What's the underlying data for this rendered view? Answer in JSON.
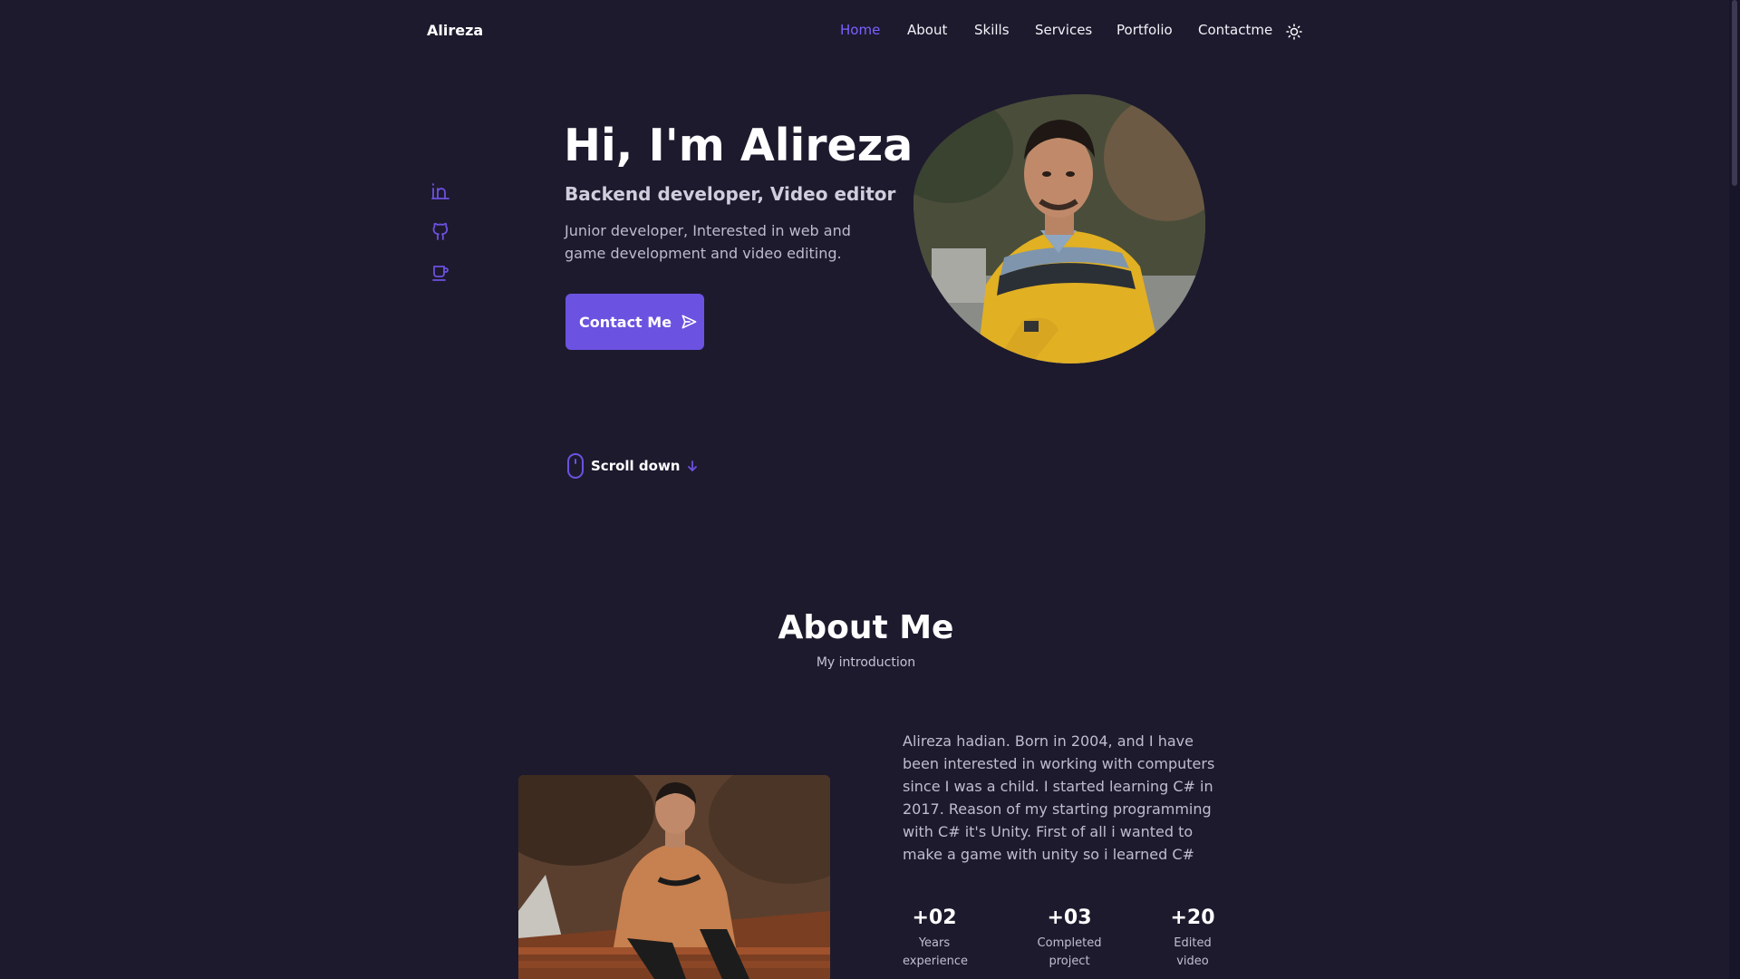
{
  "colors": {
    "background": "#1d1a2e",
    "accent": "#6c52e0",
    "nav_active": "#7b61ff",
    "text": "#ffffff",
    "muted_text": "#bfbdcd"
  },
  "header": {
    "brand": "Alireza",
    "nav": [
      {
        "label": "Home",
        "active": true
      },
      {
        "label": "About",
        "active": false
      },
      {
        "label": "Skills",
        "active": false
      },
      {
        "label": "Services",
        "active": false
      },
      {
        "label": "Portfolio",
        "active": false
      },
      {
        "label": "Contactme",
        "active": false
      }
    ],
    "theme_toggle_icon": "sun-icon"
  },
  "socials": [
    {
      "icon": "linkedin-icon"
    },
    {
      "icon": "github-icon"
    },
    {
      "icon": "coffee-cup-icon"
    }
  ],
  "hero": {
    "title": "Hi, I'm Alireza",
    "subtitle": "Backend developer, Video editor",
    "description": "Junior developer, Interested in web and game development and video editing.",
    "cta_label": "Contact Me",
    "cta_icon": "send-icon",
    "photo_icon": "profile-photo",
    "scroll_label": "Scroll down",
    "scroll_icons": [
      "mouse-icon",
      "arrow-down-icon"
    ]
  },
  "about": {
    "title": "About Me",
    "subtitle": "My introduction",
    "photo_icon": "about-photo",
    "text": "Alireza hadian. Born in 2004, and I have been interested in working with computers since I was a child. I started learning C# in 2017. Reason of my starting programming with C# it's Unity. First of all i wanted to make a game with unity so i learned C#",
    "stats": [
      {
        "value": "+02",
        "label": "Years experience"
      },
      {
        "value": "+03",
        "label": "Completed project"
      },
      {
        "value": "+20",
        "label": "Edited video"
      }
    ]
  }
}
